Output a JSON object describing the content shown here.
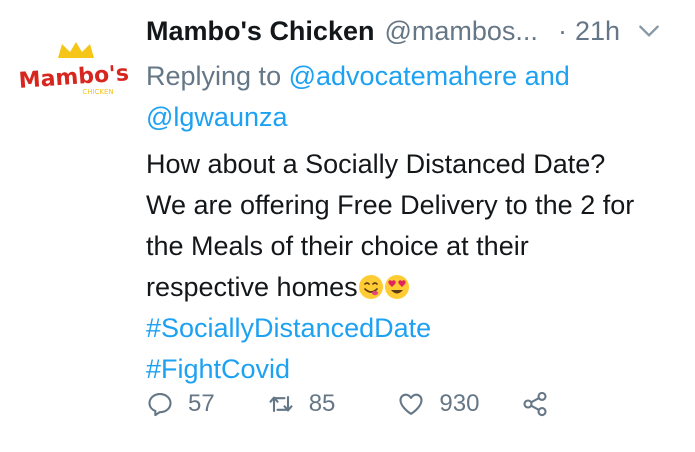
{
  "tweet": {
    "display_name": "Mambo's Chicken",
    "handle": "@mambos...",
    "dot": "·",
    "time": "21h",
    "reply_prefix": "Replying to",
    "reply_mention_1": "@advocatemahere",
    "reply_and": "and",
    "reply_mention_2": "@lgwaunza",
    "text_line_1": "How about a Socially Distanced Date?",
    "text_line_2": "We are offering Free Delivery to the 2 for",
    "text_line_3": "the Meals of their choice at their",
    "text_line_4": "respective homes",
    "hashtag_1": "#SociallyDistancedDate",
    "hashtag_2": "#FightCovid"
  },
  "avatar": {
    "logo_text": "Mambo's",
    "logo_subtext": "CHICKEN",
    "brand_red": "#d7261e",
    "brand_yellow": "#f5c518"
  },
  "actions": {
    "reply_count": "57",
    "retweet_count": "85",
    "like_count": "930",
    "icons": [
      "reply-icon",
      "retweet-icon",
      "like-icon",
      "share-icon"
    ]
  },
  "colors": {
    "text": "#14171a",
    "muted": "#657786",
    "link": "#1da1f2"
  }
}
